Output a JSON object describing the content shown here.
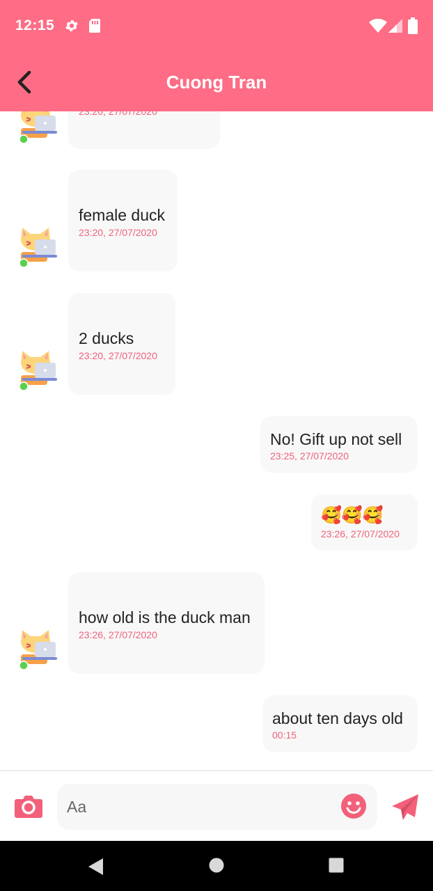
{
  "status_bar": {
    "time": "12:15"
  },
  "app_bar": {
    "title": "Cuong Tran"
  },
  "messages": [
    {
      "direction": "in",
      "text": "",
      "timestamp": "23:20, 27/07/2020"
    },
    {
      "direction": "in",
      "text": "female duck",
      "timestamp": "23:20, 27/07/2020"
    },
    {
      "direction": "in",
      "text": "2 ducks",
      "timestamp": "23:20, 27/07/2020"
    },
    {
      "direction": "out",
      "text": "No! Gift up not sell",
      "timestamp": "23:25, 27/07/2020"
    },
    {
      "direction": "out",
      "text": "🥰🥰🥰",
      "timestamp": "23:26, 27/07/2020"
    },
    {
      "direction": "in",
      "text": "how old is the duck man",
      "timestamp": "23:26, 27/07/2020"
    },
    {
      "direction": "out",
      "text": "about ten days old",
      "timestamp": "00:15"
    }
  ],
  "input": {
    "placeholder": "Aa",
    "value": ""
  },
  "icons": {
    "back": "chevron-left-icon",
    "camera": "camera-icon",
    "emoji": "smiley-icon",
    "send": "send-icon",
    "settings": "gear-icon",
    "sd_card": "sd-card-icon",
    "wifi": "wifi-icon",
    "signal": "signal-icon",
    "battery": "battery-icon"
  },
  "colors": {
    "accent": "#fe6c85",
    "timestamp": "#f0617b",
    "bubble": "#f8f8f8",
    "online": "#5ccf4f"
  }
}
